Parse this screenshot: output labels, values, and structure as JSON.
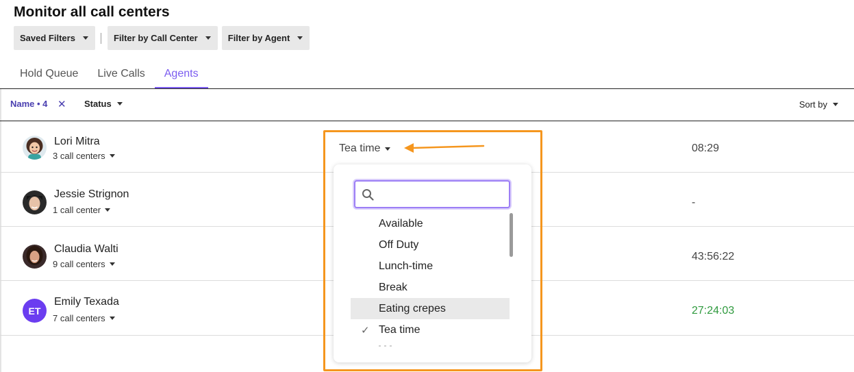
{
  "page": {
    "title": "Monitor all call centers"
  },
  "filters": {
    "saved_filters": "Saved Filters",
    "by_call_center": "Filter by Call Center",
    "by_agent": "Filter by Agent"
  },
  "tabs": [
    {
      "label": "Hold Queue",
      "active": false
    },
    {
      "label": "Live Calls",
      "active": false
    },
    {
      "label": "Agents",
      "active": true
    }
  ],
  "list_filters": {
    "name_chip": "Name • 4",
    "name_chip_clear": "✕",
    "status_label": "Status",
    "sort_label": "Sort by"
  },
  "agents": [
    {
      "name": "Lori Mitra",
      "call_centers": "3 call centers",
      "status": "Tea time",
      "time": "08:29"
    },
    {
      "name": "Jessie Strignon",
      "call_centers": "1 call center",
      "time": "-"
    },
    {
      "name": "Claudia Walti",
      "call_centers": "9 call centers",
      "time": "43:56:22"
    },
    {
      "name": "Emily Texada",
      "call_centers": "7 call centers",
      "initials": "ET",
      "time": "27:24:03",
      "time_color": "#2f9a3e"
    }
  ],
  "status_dropdown": {
    "search_value": "",
    "options": [
      {
        "label": "Available"
      },
      {
        "label": "Off Duty"
      },
      {
        "label": "Lunch-time"
      },
      {
        "label": "Break"
      },
      {
        "label": "Eating crepes",
        "highlighted": true
      },
      {
        "label": "Tea time",
        "selected": true,
        "check": "✓"
      }
    ]
  },
  "colors": {
    "accent": "#7b5cf0",
    "annotation": "#f5961e",
    "positive_time": "#2f9a3e"
  }
}
